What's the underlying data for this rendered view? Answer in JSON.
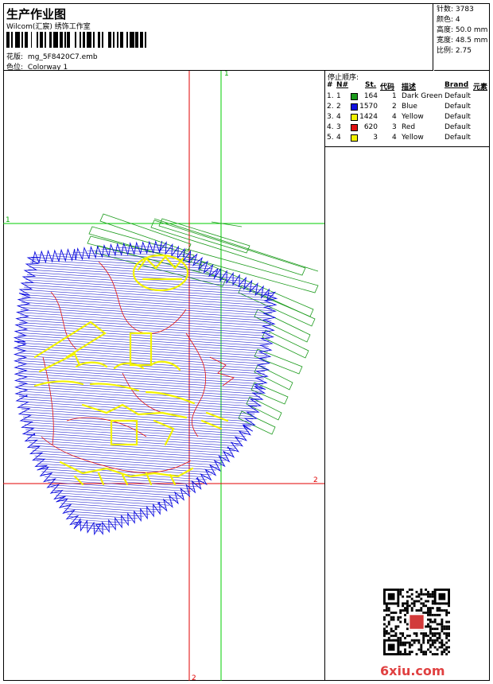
{
  "header": {
    "title": "生产作业图",
    "subtitle": "Wilcom(汇宸) 绣饰工作室",
    "design_label": "花版:",
    "design_value": "mg_5F8420C7.emb",
    "colorway_label": "色位:",
    "colorway_value": "Colorway 1"
  },
  "stats": {
    "stitches_label": "针数:",
    "stitches_value": "3783",
    "colors_label": "颜色:",
    "colors_value": "4",
    "height_label": "高度:",
    "height_value": "50.0 mm",
    "width_label": "宽度:",
    "width_value": "48.5 mm",
    "scale_label": "比例:",
    "scale_value": "2.75"
  },
  "stop_sequence": {
    "title": "停止顺序:",
    "headers": [
      "#",
      "N#",
      "St.",
      "代码",
      "描述",
      "Brand",
      "元素"
    ],
    "rows": [
      {
        "num": "1.",
        "n": "1",
        "color": "#1a9a1a",
        "st": "164",
        "code": "1",
        "desc": "Dark Green",
        "brand": "Default"
      },
      {
        "num": "2.",
        "n": "2",
        "color": "#1010e0",
        "st": "1570",
        "code": "2",
        "desc": "Blue",
        "brand": "Default"
      },
      {
        "num": "3.",
        "n": "4",
        "color": "#f2f200",
        "st": "1424",
        "code": "4",
        "desc": "Yellow",
        "brand": "Default"
      },
      {
        "num": "4.",
        "n": "3",
        "color": "#e01010",
        "st": "620",
        "code": "3",
        "desc": "Red",
        "brand": "Default"
      },
      {
        "num": "5.",
        "n": "4",
        "color": "#f2f200",
        "st": "3",
        "code": "4",
        "desc": "Yellow",
        "brand": "Default"
      }
    ]
  },
  "guides": {
    "green_vertical_label": "1",
    "green_horizontal_label": "1",
    "red_horizontal_label": "2",
    "red_vertical_label": "2"
  },
  "watermark": "6xiu.com",
  "colors": {
    "green": "#1a9a1a",
    "blue": "#1010e0",
    "yellow": "#f2f200",
    "red": "#e01010",
    "guide_green": "#00cc00",
    "guide_red": "#e00000"
  }
}
